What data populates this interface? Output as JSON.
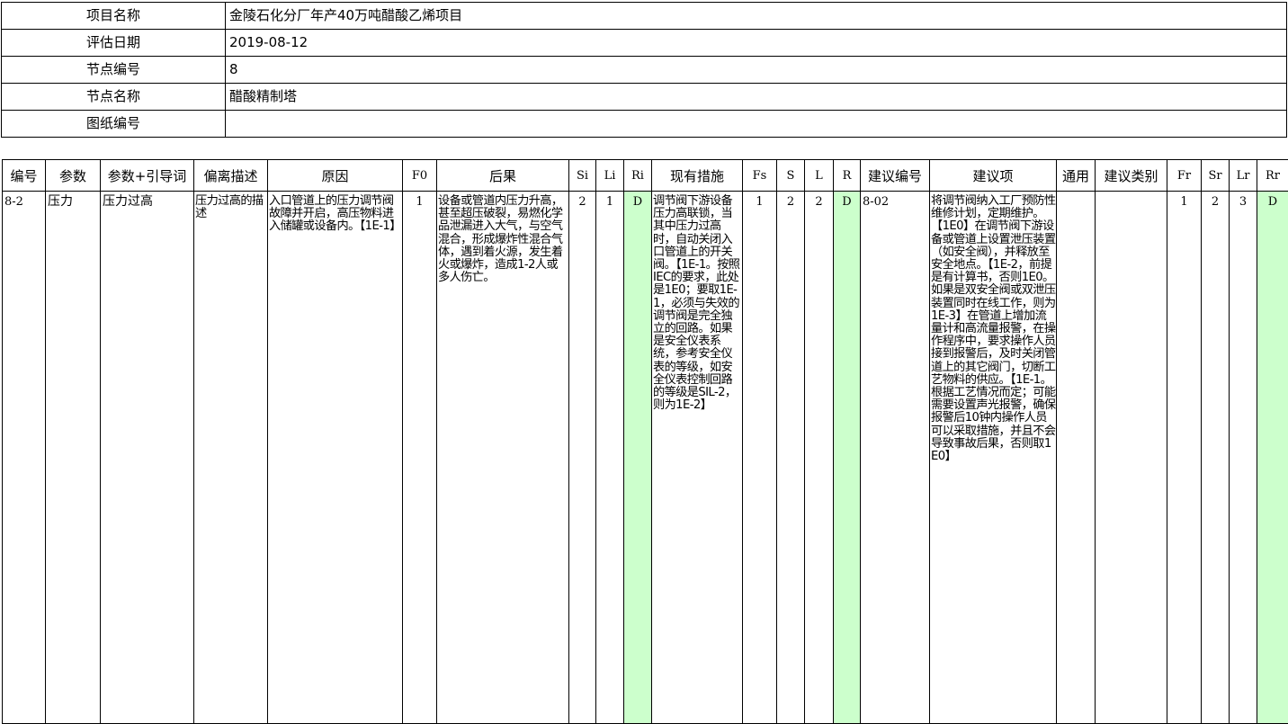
{
  "info": {
    "project_name_label": "项目名称",
    "project_name": "金陵石化分厂年产40万吨醋酸乙烯项目",
    "eval_date_label": "评估日期",
    "eval_date": "2019-08-12",
    "node_no_label": "节点编号",
    "node_no": "8",
    "node_name_label": "节点名称",
    "node_name": "醋酸精制塔",
    "drawing_no_label": "图纸编号",
    "drawing_no": ""
  },
  "columns": [
    "编号",
    "参数",
    "参数+引导词",
    "偏离描述",
    "原因",
    "F0",
    "后果",
    "Si",
    "Li",
    "Ri",
    "现有措施",
    "Fs",
    "S",
    "L",
    "R",
    "建议编号",
    "建议项",
    "通用",
    "建议类别",
    "Fr",
    "Sr",
    "Lr",
    "Rr"
  ],
  "row": {
    "no": "8-2",
    "param": "压力",
    "param_guide": "压力过高",
    "deviation": "压力过高的描述",
    "cause": "入口管道上的压力调节阀故障并开启，高压物料进入储罐或设备内。【1E-1】",
    "f0": "1",
    "consequence": "设备或管道内压力升高，甚至超压破裂，易燃化学品泄漏进入大气，与空气混合，形成爆炸性混合气体，遇到着火源，发生着火或爆炸，造成1-2人或多人伤亡。",
    "si": "2",
    "li": "1",
    "ri": "D",
    "measures": "调节阀下游设备压力高联锁，当其中压力过高时，自动关闭入口管道上的开关阀。【1E-1。按照IEC的要求，此处是1E0；要取1E-1，必须与失效的调节阀是完全独立的回路。如果是安全仪表系统，参考安全仪表的等级，如安全仪表控制回路的等级是SIL-2，则为1E-2】",
    "fs": "1",
    "s": "2",
    "l": "2",
    "r": "D",
    "rec_no": "8-02",
    "recommendation": "将调节阀纳入工厂预防性维修计划，定期维护。【1E0】在调节阀下游设备或管道上设置泄压装置（如安全阀），并释放至安全地点。【1E-2，前提是有计算书，否则1E0。如果是双安全阀或双泄压装置同时在线工作，则为1E-3】在管道上增加流量计和高流量报警，在操作程序中，要求操作人员接到报警后，及时关闭管道上的其它阀门，切断工艺物料的供应。【1E-1。根据工艺情况而定；可能需要设置声光报警，确保报警后10钟内操作人员可以采取措施，并且不会导致事故后果，否则取1E0】",
    "general": "",
    "rec_type": "",
    "fr": "1",
    "sr": "2",
    "lr": "3",
    "rr": "D"
  },
  "colors": {
    "risk_cell_bg": "#ccffcc",
    "border": "#000000"
  }
}
